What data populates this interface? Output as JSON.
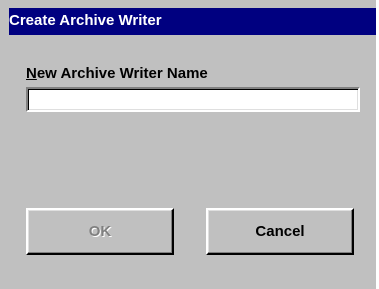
{
  "window": {
    "title": "Create Archive Writer"
  },
  "form": {
    "label_accel": "N",
    "label_rest": "ew Archive Writer Name",
    "name_value": ""
  },
  "buttons": {
    "ok_label": "OK",
    "ok_enabled": false,
    "cancel_label": "Cancel"
  },
  "colors": {
    "titlebar": "#000080",
    "dialog_face": "#c0c0c0",
    "disabled_text": "#808080"
  }
}
